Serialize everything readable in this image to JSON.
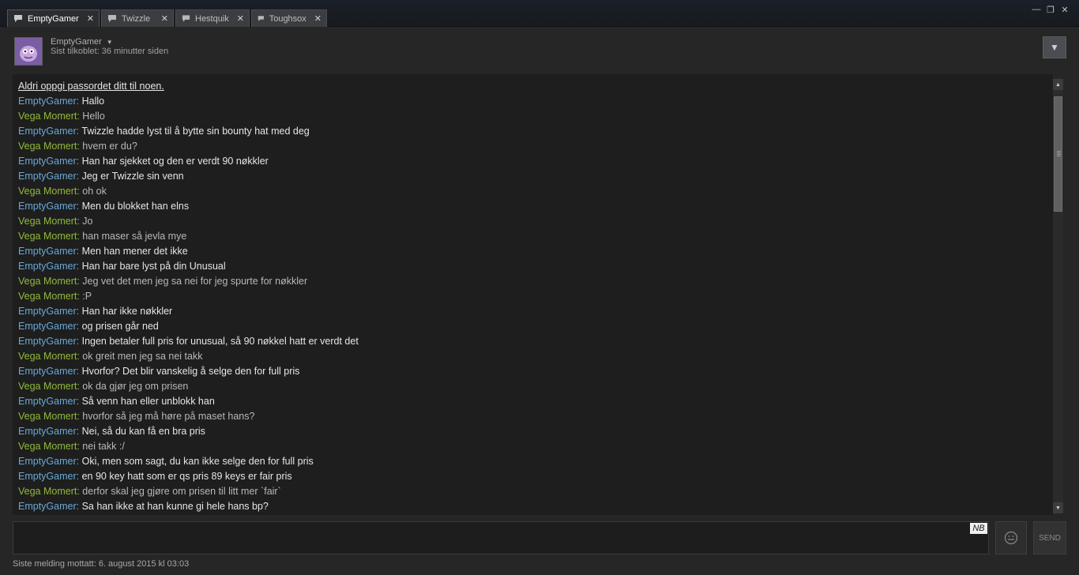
{
  "tabs": [
    {
      "label": "EmptyGamer",
      "active": true
    },
    {
      "label": "Twizzle",
      "active": false
    },
    {
      "label": "Hestquik",
      "active": false
    },
    {
      "label": "Toughsox",
      "active": false
    }
  ],
  "header": {
    "username": "EmptyGamer",
    "last_online": "Sist tilkoblet: 36 minutter siden"
  },
  "chat": {
    "warning": "Aldri oppgi passordet ditt til noen.",
    "messages": [
      {
        "sender": "EmptyGamer",
        "text": "Hallo"
      },
      {
        "sender": "Vega Momert",
        "text": "Hello"
      },
      {
        "sender": "EmptyGamer",
        "text": "Twizzle hadde lyst til å bytte sin bounty hat med deg"
      },
      {
        "sender": "Vega Momert",
        "text": "hvem er du?"
      },
      {
        "sender": "EmptyGamer",
        "text": "Han har sjekket og den er verdt 90 nøkkler"
      },
      {
        "sender": "EmptyGamer",
        "text": "Jeg er Twizzle sin venn"
      },
      {
        "sender": "Vega Momert",
        "text": "oh ok"
      },
      {
        "sender": "EmptyGamer",
        "text": "Men du blokket han elns"
      },
      {
        "sender": "Vega Momert",
        "text": "Jo"
      },
      {
        "sender": "Vega Momert",
        "text": "han maser så jevla mye"
      },
      {
        "sender": "EmptyGamer",
        "text": "Men han mener det ikke"
      },
      {
        "sender": "EmptyGamer",
        "text": "Han har bare lyst på din Unusual"
      },
      {
        "sender": "Vega Momert",
        "text": "Jeg vet det men jeg sa nei for jeg spurte for nøkkler"
      },
      {
        "sender": "Vega Momert",
        "text": ":P"
      },
      {
        "sender": "EmptyGamer",
        "text": "Han har ikke nøkkler"
      },
      {
        "sender": "EmptyGamer",
        "text": "og prisen går ned"
      },
      {
        "sender": "EmptyGamer",
        "text": "Ingen betaler full pris for unusual, så 90 nøkkel hatt er verdt det"
      },
      {
        "sender": "Vega Momert",
        "text": "ok greit men jeg sa nei takk"
      },
      {
        "sender": "EmptyGamer",
        "text": "Hvorfor? Det blir vanskelig å selge den for full pris"
      },
      {
        "sender": "Vega Momert",
        "text": "ok da gjør jeg om prisen"
      },
      {
        "sender": "EmptyGamer",
        "text": "Så venn han eller unblokk han"
      },
      {
        "sender": "Vega Momert",
        "text": "hvorfor så jeg må høre på maset hans?"
      },
      {
        "sender": "EmptyGamer",
        "text": "Nei, så du kan få en bra pris"
      },
      {
        "sender": "Vega Momert",
        "text": "nei takk :/"
      },
      {
        "sender": "EmptyGamer",
        "text": "Oki, men som sagt, du kan ikke selge den for full pris"
      },
      {
        "sender": "EmptyGamer",
        "text": "en 90 key hatt som er qs pris 89 keys er fair pris"
      },
      {
        "sender": "Vega Momert",
        "text": "derfor skal jeg gjøre om prisen til litt mer `fair`"
      },
      {
        "sender": "EmptyGamer",
        "text": "Sa han ikke at han kunne gi hele hans bp?"
      }
    ]
  },
  "input": {
    "nb_tag": "NB",
    "send_label": "SEND"
  },
  "status": "Siste melding mottatt: 6. august 2015 kl 03:03",
  "colors": {
    "sender_self": "#6aa9d6",
    "sender_other": "#90ba3c"
  }
}
